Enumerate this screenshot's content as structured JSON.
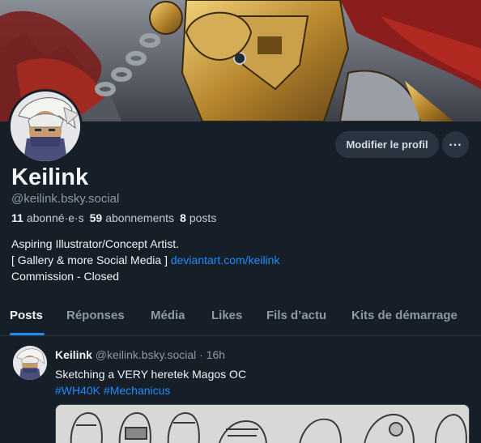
{
  "profile": {
    "display_name": "Keilink",
    "handle": "@keilink.bsky.social",
    "followers_count": "11",
    "followers_label": "abonné·e·s",
    "following_count": "59",
    "following_label": "abonnements",
    "posts_count": "8",
    "posts_label": "posts",
    "bio_line1": "Aspiring Illustrator/Concept Artist.",
    "bio_line2_prefix": "[ Gallery & more Social Media ]",
    "bio_link": "deviantart.com/keilink",
    "bio_line3": "Commission - Closed"
  },
  "actions": {
    "edit_label": "Modifier le profil",
    "more_label": "..."
  },
  "tabs": [
    {
      "label": "Posts",
      "active": true
    },
    {
      "label": "Réponses",
      "active": false
    },
    {
      "label": "Média",
      "active": false
    },
    {
      "label": "Likes",
      "active": false
    },
    {
      "label": "Fils d’actu",
      "active": false
    },
    {
      "label": "Kits de démarrage",
      "active": false
    }
  ],
  "post": {
    "author_name": "Keilink",
    "author_handle": "@keilink.bsky.social",
    "separator": "·",
    "time": "16h",
    "text": "Sketching a VERY heretek Magos OC",
    "hashtag1": "#WH40K",
    "hashtag2": "#Mechanicus"
  },
  "colors": {
    "background": "#161e27",
    "accent": "#208bfe",
    "muted_text": "#8d99a6",
    "button_bg": "#2a3441"
  },
  "icons": {
    "more": "ellipsis-horizontal-icon"
  }
}
